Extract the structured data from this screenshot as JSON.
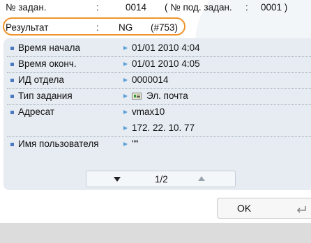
{
  "header": {
    "job_no_label": "№ задан.",
    "job_no_colon": ":",
    "job_no_value": "0014",
    "sub_job_label": "( № под. задан.",
    "sub_job_colon": ":",
    "sub_job_value": "0001 )",
    "result_label": "Результат",
    "result_colon": ":",
    "result_value": "NG",
    "result_code": "(#753)"
  },
  "details": {
    "rows": [
      {
        "label": "Время начала",
        "value": "01/01 2010 4:04"
      },
      {
        "label": "Время оконч.",
        "value": "01/01 2010 4:05"
      },
      {
        "label": "ИД отдела",
        "value": "0000014"
      },
      {
        "label": "Тип задания",
        "value": "Эл. почта",
        "icon": "email-icon"
      },
      {
        "label": "Адресат",
        "value": "vmax10",
        "value2": "172. 22. 10. 77"
      },
      {
        "label": "Имя пользователя",
        "value": "\"\""
      }
    ]
  },
  "pager": {
    "current_page": "1/2"
  },
  "buttons": {
    "ok_label": "OK"
  },
  "colors": {
    "highlight": "#f0932b",
    "panel_bg": "#e6ecf2",
    "bullet": "#4a79c2",
    "arrow": "#5aa0d8"
  }
}
